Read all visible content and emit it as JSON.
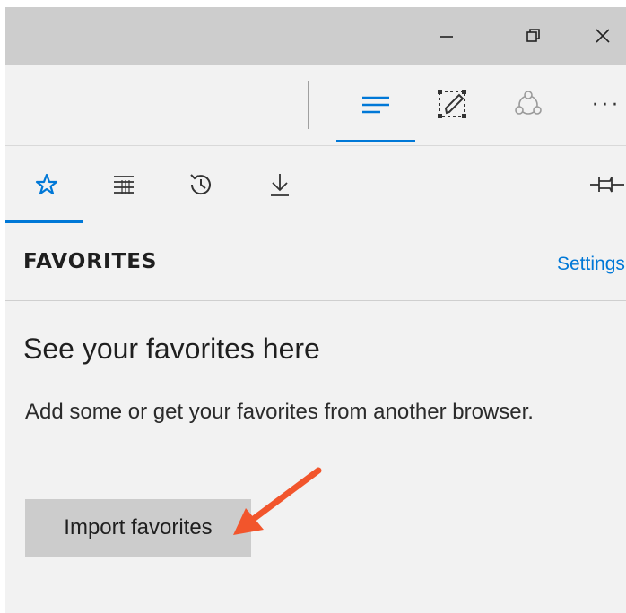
{
  "titlebar": {
    "minimize_icon": "minimize-icon",
    "restore_icon": "restore-icon",
    "close_icon": "close-icon"
  },
  "toolbar": {
    "hub_icon": "hub-icon",
    "web_note_icon": "web-note-icon",
    "share_icon": "share-icon",
    "more_label": "···"
  },
  "hub": {
    "tabs": [
      {
        "name": "favorites",
        "icon": "star-icon",
        "active": true
      },
      {
        "name": "reading-list",
        "icon": "reading-list-icon",
        "active": false
      },
      {
        "name": "history",
        "icon": "history-icon",
        "active": false
      },
      {
        "name": "downloads",
        "icon": "download-icon",
        "active": false
      }
    ],
    "pin_icon": "pin-icon",
    "section_title": "FAVORITES",
    "settings_link": "Settings",
    "empty_heading": "See your favorites here",
    "empty_body": "Add some or get your favorites from another browser.",
    "import_button": "Import favorites"
  },
  "colors": {
    "accent": "#0078d7",
    "annotation_arrow": "#f2552c",
    "button_bg": "#cccccc"
  }
}
